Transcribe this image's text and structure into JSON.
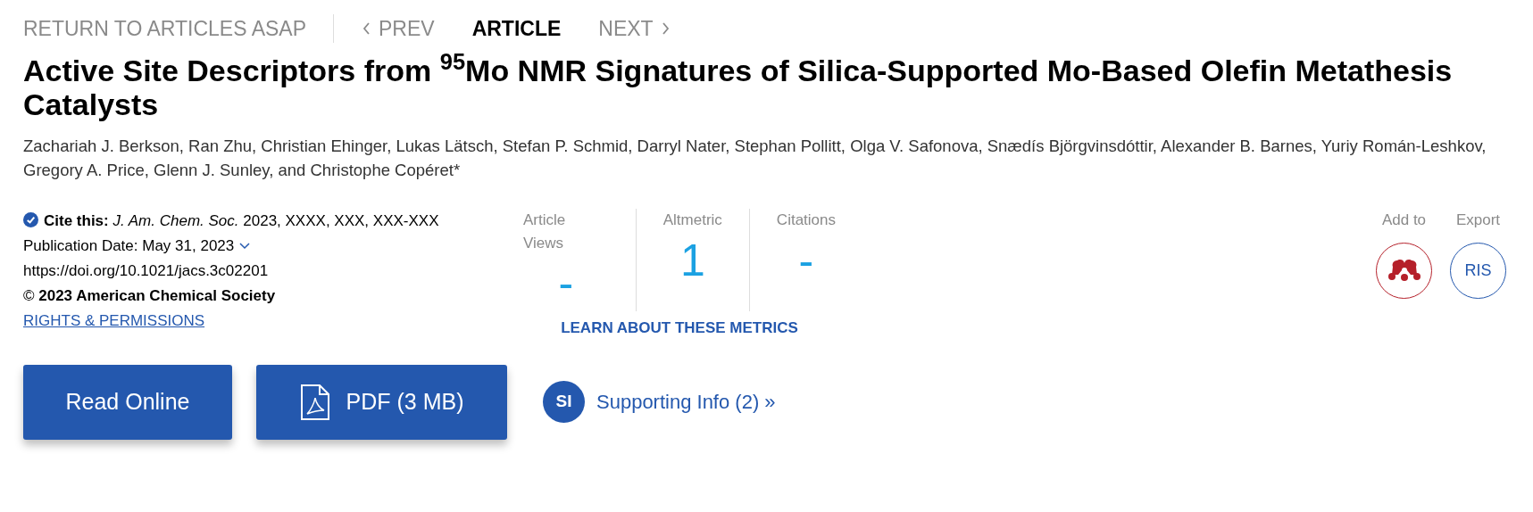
{
  "nav": {
    "return_link": "RETURN TO ARTICLES ASAP",
    "items": [
      {
        "kind": "prev",
        "label": "PREV",
        "selected": false
      },
      {
        "kind": "current",
        "label": "ARTICLE",
        "selected": true
      },
      {
        "kind": "next",
        "label": "NEXT",
        "selected": false
      }
    ]
  },
  "title": "Active Site Descriptors from $^{95}$Mo NMR Signatures of Silica-Supported Mo-Based Olefin Metathesis Catalysts",
  "authors": "Zachariah J. Berkson, Ran Zhu, Christian Ehinger, Lukas Lätsch, Stefan P. Schmid, Darryl Nater, Stephan Pollitt, Olga V. Safonova, Snædís Björgvinsdóttir, Alexander B. Barnes, Yuriy Román-Leshkov, Gregory A. Price, Glenn J. Sunley, and Christophe Copéret*",
  "citation": {
    "cite": "**Cite this:** *J. Am. Chem. Soc.*  2023, XXXX, XXX, XXX-XXX",
    "publication_date": "Publication Date: May 31, 2023",
    "doi": "https://doi.org/10.1021/jacs.3c02201",
    "copyright": "© **2023 American Chemical Society**",
    "rights_link": "RIGHTS & PERMISSIONS"
  },
  "metrics": {
    "items": [
      {
        "label": "Article Views",
        "value": "-"
      },
      {
        "label": "Altmetric",
        "value": "1"
      },
      {
        "label": "Citations",
        "value": "-"
      }
    ],
    "learn_link": "LEARN ABOUT THESE METRICS"
  },
  "tools": [
    {
      "kind": "mendeley",
      "label": "Add to"
    },
    {
      "kind": "ris",
      "label": "Export",
      "button": "RIS"
    }
  ],
  "actions": {
    "read_online": "Read Online",
    "pdf": "PDF (3 MB)",
    "supporting_badge": "SI",
    "supporting_info": "Supporting Info (2) »"
  }
}
